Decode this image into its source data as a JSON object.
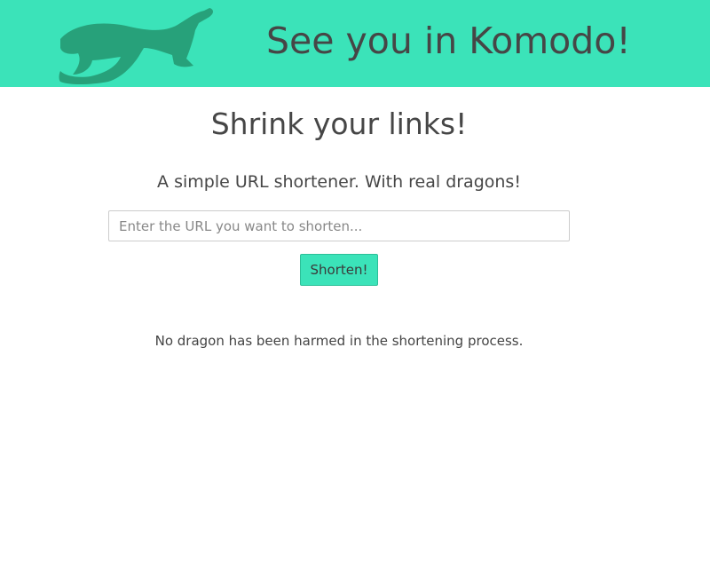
{
  "header": {
    "logo_icon": "komodo-dragon-icon",
    "title": "See you in Komodo!"
  },
  "main": {
    "title": "Shrink your links!",
    "subtitle": "A simple URL shortener. With real dragons!",
    "url_input": {
      "placeholder": "Enter the URL you want to shorten...",
      "value": ""
    },
    "shorten_label": "Shorten!",
    "footnote": "No dragon has been harmed in the shortening process."
  },
  "colors": {
    "accent": "#3be3b9",
    "logo": "#27a17a",
    "text": "#464646"
  }
}
